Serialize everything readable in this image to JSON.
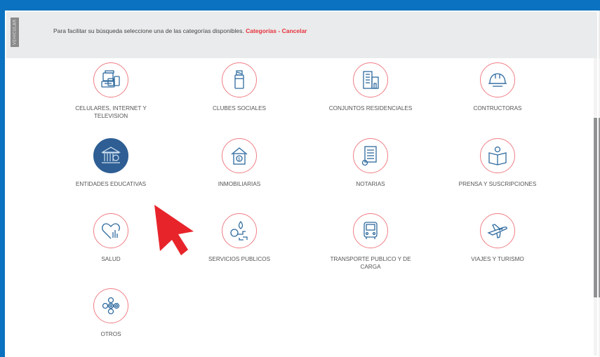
{
  "info": {
    "side_label": "VEHICULAR",
    "message": "Para facilitar su búsqueda seleccione una de las categorías disponibles.",
    "categorias_link": "Categorías",
    "separator": " - ",
    "cancelar_link": "Cancelar"
  },
  "categories": [
    {
      "label": "CELULARES, INTERNET Y TELEVISION",
      "icon": "devices-icon"
    },
    {
      "label": "CLUBES SOCIALES",
      "icon": "bottle-icon"
    },
    {
      "label": "CONJUNTOS RESIDENCIALES",
      "icon": "building-icon"
    },
    {
      "label": "CONTRUCTORAS",
      "icon": "helmet-icon"
    },
    {
      "label": "ENTIDADES EDUCATIVAS",
      "icon": "institution-icon"
    },
    {
      "label": "INMOBILIARIAS",
      "icon": "house-money-icon"
    },
    {
      "label": "NOTARIAS",
      "icon": "document-seal-icon"
    },
    {
      "label": "PRENSA Y SUSCRIPCIONES",
      "icon": "reader-icon"
    },
    {
      "label": "SALUD",
      "icon": "heart-pulse-icon"
    },
    {
      "label": "SERVICIOS PUBLICOS",
      "icon": "utilities-icon"
    },
    {
      "label": "TRANSPORTE PUBLICO Y DE CARGA",
      "icon": "bus-icon"
    },
    {
      "label": "VIAJES Y TURISMO",
      "icon": "airplane-icon"
    },
    {
      "label": "OTROS",
      "icon": "circles-icon"
    }
  ],
  "colors": {
    "frame": "#0a72c0",
    "accent": "#e8303a",
    "icon_ring": "#f07f86",
    "icon_line": "#2e6a9e",
    "selected": "#2e5e93"
  }
}
